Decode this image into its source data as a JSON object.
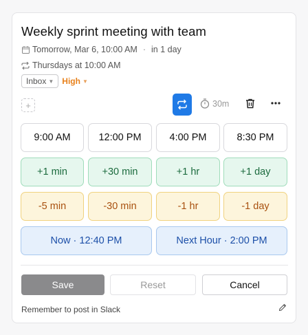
{
  "event": {
    "title": "Weekly sprint meeting with team",
    "date_text": "Tomorrow, Mar 6, 10:00 AM",
    "separator": "·",
    "relative": "in 1 day",
    "recurrence": "Thursdays at 10:00 AM"
  },
  "tags": {
    "list": "Inbox",
    "priority": "High"
  },
  "toolbar": {
    "duration": "30m"
  },
  "times": [
    "9:00 AM",
    "12:00 PM",
    "4:00 PM",
    "8:30 PM"
  ],
  "increments": [
    "+1 min",
    "+30 min",
    "+1 hr",
    "+1 day"
  ],
  "decrements": [
    "-5 min",
    "-30 min",
    "-1 hr",
    "-1 day"
  ],
  "quick": [
    "Now · 12:40 PM",
    "Next Hour · 2:00 PM"
  ],
  "actions": {
    "save": "Save",
    "reset": "Reset",
    "cancel": "Cancel"
  },
  "note": "Remember to post in Slack",
  "colors": {
    "accent": "#1f7ae6",
    "priority": "#e8811b",
    "plus_bg": "#e6f7ee",
    "minus_bg": "#fdf5dc",
    "quick_bg": "#e6f0fc"
  }
}
